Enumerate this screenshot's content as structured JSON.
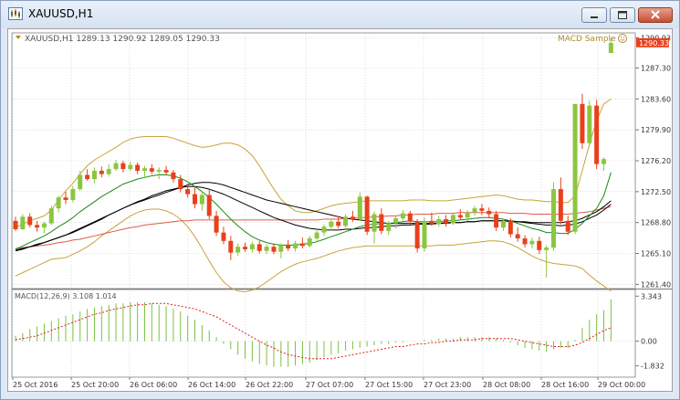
{
  "window": {
    "title": "XAUUSD,H1"
  },
  "chart_header": {
    "info": "XAUUSD,H1  1289.13 1290.92 1289.05 1290.33",
    "expert": "MACD Sample",
    "expert_icon": "smiley-icon"
  },
  "colors": {
    "background": "#ffffff",
    "grid": "#c8c8c8",
    "bull": "#8cc63f",
    "bear": "#e8401c",
    "bollinger": "#c9a33a",
    "ma_green": "#1a8a1a",
    "ma_black": "#000000",
    "ma_red": "#e05a4a",
    "macd_hist": "#7ac143",
    "macd_signal": "#e02020",
    "current_price_box": "#e8401c"
  },
  "price_axis": {
    "labels": [
      "1290.93",
      "1287.30",
      "1283.60",
      "1279.90",
      "1276.20",
      "1272.50",
      "1268.80",
      "1265.10",
      "1261.40"
    ],
    "current_price": "1290.33"
  },
  "macd_axis": {
    "labels": [
      "3.343",
      "0.00",
      "-1.832"
    ]
  },
  "macd_label": "MACD(12,26,9) 3.108 1.014",
  "time_axis": {
    "labels": [
      "25 Oct 2016",
      "25 Oct 20:00",
      "26 Oct 06:00",
      "26 Oct 14:00",
      "26 Oct 22:00",
      "27 Oct 07:00",
      "27 Oct 15:00",
      "27 Oct 23:00",
      "28 Oct 08:00",
      "28 Oct 16:00",
      "29 Oct 00:00"
    ]
  },
  "chart_data": {
    "type": "candlestick",
    "symbol": "XAUUSD",
    "timeframe": "H1",
    "ylim": [
      1261.0,
      1291.4
    ],
    "macd_ylim": [
      -2.6,
      3.7
    ],
    "candles": [
      [
        1269.0,
        1269.5,
        1267.8,
        1268.0
      ],
      [
        1268.0,
        1269.8,
        1267.9,
        1269.5
      ],
      [
        1269.5,
        1269.9,
        1268.2,
        1268.5
      ],
      [
        1268.5,
        1269.0,
        1267.7,
        1268.2
      ],
      [
        1268.2,
        1268.9,
        1267.5,
        1268.7
      ],
      [
        1268.7,
        1270.8,
        1268.5,
        1270.5
      ],
      [
        1270.5,
        1272.0,
        1270.0,
        1271.8
      ],
      [
        1271.8,
        1272.5,
        1271.0,
        1271.5
      ],
      [
        1271.5,
        1273.2,
        1271.2,
        1272.8
      ],
      [
        1272.8,
        1275.0,
        1272.6,
        1274.5
      ],
      [
        1274.5,
        1275.2,
        1273.8,
        1274.0
      ],
      [
        1274.0,
        1275.4,
        1273.5,
        1275.0
      ],
      [
        1275.0,
        1275.5,
        1274.2,
        1274.6
      ],
      [
        1274.6,
        1275.8,
        1274.3,
        1275.2
      ],
      [
        1275.2,
        1276.3,
        1275.0,
        1275.9
      ],
      [
        1275.9,
        1276.2,
        1274.8,
        1275.2
      ],
      [
        1275.2,
        1276.1,
        1275.0,
        1275.7
      ],
      [
        1275.7,
        1276.0,
        1274.6,
        1275.0
      ],
      [
        1275.0,
        1275.6,
        1274.2,
        1275.3
      ],
      [
        1275.3,
        1275.8,
        1274.6,
        1274.9
      ],
      [
        1274.9,
        1275.4,
        1274.0,
        1275.1
      ],
      [
        1275.1,
        1275.6,
        1274.5,
        1274.8
      ],
      [
        1274.8,
        1275.1,
        1273.6,
        1274.0
      ],
      [
        1274.0,
        1274.5,
        1272.4,
        1272.8
      ],
      [
        1272.8,
        1273.5,
        1271.8,
        1272.2
      ],
      [
        1272.2,
        1273.0,
        1270.5,
        1271.0
      ],
      [
        1271.0,
        1272.6,
        1270.2,
        1272.1
      ],
      [
        1272.1,
        1272.8,
        1269.2,
        1269.6
      ],
      [
        1269.6,
        1270.2,
        1267.2,
        1267.6
      ],
      [
        1267.6,
        1268.3,
        1266.2,
        1266.6
      ],
      [
        1266.6,
        1267.2,
        1264.3,
        1265.2
      ],
      [
        1265.2,
        1266.3,
        1264.8,
        1265.9
      ],
      [
        1265.9,
        1266.4,
        1265.3,
        1265.6
      ],
      [
        1265.6,
        1266.5,
        1265.2,
        1266.2
      ],
      [
        1266.2,
        1266.6,
        1265.1,
        1265.4
      ],
      [
        1265.4,
        1266.2,
        1265.0,
        1265.9
      ],
      [
        1265.9,
        1266.3,
        1265.0,
        1265.3
      ],
      [
        1265.3,
        1266.3,
        1264.5,
        1266.1
      ],
      [
        1266.1,
        1266.7,
        1265.4,
        1265.7
      ],
      [
        1265.7,
        1266.6,
        1265.3,
        1266.3
      ],
      [
        1266.3,
        1267.0,
        1265.7,
        1266.0
      ],
      [
        1266.0,
        1267.2,
        1265.8,
        1266.9
      ],
      [
        1266.9,
        1268.0,
        1266.5,
        1267.6
      ],
      [
        1267.6,
        1268.6,
        1267.2,
        1268.3
      ],
      [
        1268.3,
        1269.1,
        1267.8,
        1268.9
      ],
      [
        1268.9,
        1269.6,
        1268.1,
        1268.4
      ],
      [
        1268.4,
        1269.8,
        1268.2,
        1269.5
      ],
      [
        1269.5,
        1270.2,
        1268.9,
        1269.2
      ],
      [
        1269.2,
        1272.4,
        1269.0,
        1271.9
      ],
      [
        1271.9,
        1272.0,
        1267.3,
        1267.7
      ],
      [
        1267.7,
        1270.1,
        1266.3,
        1269.8
      ],
      [
        1269.8,
        1270.5,
        1267.4,
        1267.8
      ],
      [
        1267.8,
        1269.0,
        1267.3,
        1268.7
      ],
      [
        1268.7,
        1269.6,
        1268.1,
        1269.3
      ],
      [
        1269.3,
        1270.3,
        1268.8,
        1269.9
      ],
      [
        1269.9,
        1270.2,
        1268.6,
        1268.9
      ],
      [
        1268.9,
        1269.2,
        1265.2,
        1265.7
      ],
      [
        1265.7,
        1269.4,
        1265.3,
        1269.0
      ],
      [
        1269.0,
        1270.0,
        1268.4,
        1268.6
      ],
      [
        1268.6,
        1269.6,
        1268.3,
        1269.2
      ],
      [
        1269.2,
        1269.7,
        1268.3,
        1268.7
      ],
      [
        1268.7,
        1270.0,
        1268.5,
        1269.7
      ],
      [
        1269.7,
        1270.4,
        1269.1,
        1269.4
      ],
      [
        1269.4,
        1270.3,
        1269.0,
        1270.0
      ],
      [
        1270.0,
        1270.8,
        1269.6,
        1270.5
      ],
      [
        1270.5,
        1271.0,
        1269.7,
        1270.2
      ],
      [
        1270.2,
        1270.6,
        1269.3,
        1269.8
      ],
      [
        1269.8,
        1270.2,
        1267.8,
        1268.2
      ],
      [
        1268.2,
        1269.3,
        1267.8,
        1269.0
      ],
      [
        1269.0,
        1269.3,
        1267.0,
        1267.4
      ],
      [
        1267.4,
        1268.2,
        1266.5,
        1266.9
      ],
      [
        1266.9,
        1267.3,
        1265.8,
        1266.2
      ],
      [
        1266.2,
        1267.0,
        1265.7,
        1266.6
      ],
      [
        1266.6,
        1267.1,
        1265.0,
        1265.5
      ],
      [
        1265.5,
        1266.1,
        1262.2,
        1265.8
      ],
      [
        1265.8,
        1273.6,
        1265.4,
        1272.8
      ],
      [
        1272.8,
        1274.2,
        1268.6,
        1269.0
      ],
      [
        1269.0,
        1269.6,
        1267.3,
        1267.7
      ],
      [
        1267.7,
        1274.5,
        1267.4,
        1283.0
      ],
      [
        1283.0,
        1284.2,
        1277.6,
        1278.3
      ],
      [
        1278.3,
        1283.4,
        1277.9,
        1282.8
      ],
      [
        1282.8,
        1283.5,
        1275.2,
        1275.8
      ],
      [
        1275.8,
        1276.6,
        1275.0,
        1276.4
      ],
      [
        1289.1,
        1290.9,
        1289.1,
        1290.3
      ]
    ],
    "ma_green": [
      1265.6,
      1266.0,
      1266.4,
      1266.8,
      1267.2,
      1267.7,
      1268.3,
      1268.8,
      1269.4,
      1270.1,
      1270.7,
      1271.3,
      1271.9,
      1272.4,
      1272.9,
      1273.4,
      1273.7,
      1274.0,
      1274.2,
      1274.4,
      1274.5,
      1274.5,
      1274.4,
      1274.1,
      1273.7,
      1273.1,
      1272.5,
      1271.8,
      1271.0,
      1270.1,
      1269.2,
      1268.4,
      1267.7,
      1267.1,
      1266.7,
      1266.4,
      1266.2,
      1266.1,
      1266.1,
      1266.1,
      1266.2,
      1266.3,
      1266.5,
      1266.8,
      1267.1,
      1267.4,
      1267.7,
      1268.0,
      1268.3,
      1268.5,
      1268.6,
      1268.7,
      1268.7,
      1268.8,
      1268.9,
      1269.0,
      1268.9,
      1268.9,
      1268.9,
      1268.9,
      1269.0,
      1269.0,
      1269.1,
      1269.2,
      1269.3,
      1269.4,
      1269.4,
      1269.3,
      1269.2,
      1269.0,
      1268.7,
      1268.4,
      1268.1,
      1267.9,
      1267.6,
      1267.6,
      1267.5,
      1267.5,
      1268.0,
      1268.7,
      1269.6,
      1270.5,
      1272.0,
      1274.8
    ],
    "ma_black": [
      1265.4,
      1265.6,
      1265.9,
      1266.1,
      1266.4,
      1266.7,
      1267.0,
      1267.3,
      1267.6,
      1268.0,
      1268.4,
      1268.8,
      1269.2,
      1269.7,
      1270.1,
      1270.5,
      1270.9,
      1271.3,
      1271.6,
      1272.0,
      1272.3,
      1272.6,
      1272.8,
      1273.0,
      1273.1,
      1273.1,
      1273.0,
      1272.8,
      1272.5,
      1272.2,
      1271.8,
      1271.4,
      1271.0,
      1270.6,
      1270.2,
      1269.8,
      1269.4,
      1269.1,
      1268.8,
      1268.5,
      1268.3,
      1268.1,
      1268.0,
      1267.9,
      1267.9,
      1267.9,
      1268.0,
      1268.0,
      1268.1,
      1268.2,
      1268.2,
      1268.3,
      1268.4,
      1268.4,
      1268.5,
      1268.5,
      1268.6,
      1268.6,
      1268.6,
      1268.7,
      1268.7,
      1268.8,
      1268.8,
      1268.9,
      1268.9,
      1269.0,
      1269.0,
      1269.0,
      1269.0,
      1268.9,
      1268.9,
      1268.8,
      1268.7,
      1268.6,
      1268.5,
      1268.5,
      1268.4,
      1268.5,
      1268.6,
      1268.9,
      1269.3,
      1269.7,
      1270.3,
      1271.0
    ],
    "ma_black2": [
      1265.5,
      1265.7,
      1265.9,
      1266.2,
      1266.4,
      1266.7,
      1267.0,
      1267.3,
      1267.7,
      1268.1,
      1268.5,
      1268.9,
      1269.3,
      1269.7,
      1270.1,
      1270.5,
      1270.9,
      1271.2,
      1271.5,
      1271.8,
      1272.1,
      1272.4,
      1272.7,
      1273.0,
      1273.3,
      1273.5,
      1273.6,
      1273.6,
      1273.5,
      1273.3,
      1273.0,
      1272.7,
      1272.4,
      1272.1,
      1271.8,
      1271.5,
      1271.3,
      1271.1,
      1270.9,
      1270.7,
      1270.5,
      1270.3,
      1270.1,
      1269.9,
      1269.7,
      1269.5,
      1269.3,
      1269.2,
      1269.1,
      1269.0,
      1268.9,
      1268.8,
      1268.7,
      1268.7,
      1268.7,
      1268.7,
      1268.7,
      1268.7,
      1268.7,
      1268.7,
      1268.8,
      1268.8,
      1268.8,
      1268.9,
      1268.9,
      1269.0,
      1269.0,
      1269.0,
      1269.0,
      1269.0,
      1268.9,
      1268.9,
      1268.8,
      1268.8,
      1268.8,
      1268.8,
      1268.8,
      1268.9,
      1269.0,
      1269.3,
      1269.7,
      1270.1,
      1270.7,
      1271.4
    ],
    "ma_red": [
      1265.7,
      1265.8,
      1265.9,
      1266.0,
      1266.1,
      1266.2,
      1266.4,
      1266.5,
      1266.7,
      1266.8,
      1267.0,
      1267.2,
      1267.4,
      1267.6,
      1267.8,
      1268.0,
      1268.2,
      1268.3,
      1268.5,
      1268.6,
      1268.7,
      1268.8,
      1268.9,
      1269.0,
      1269.0,
      1269.1,
      1269.1,
      1269.1,
      1269.1,
      1269.1,
      1269.1,
      1269.1,
      1269.1,
      1269.1,
      1269.1,
      1269.1,
      1269.1,
      1269.1,
      1269.1,
      1269.1,
      1269.1,
      1269.1,
      1269.1,
      1269.2,
      1269.2,
      1269.2,
      1269.3,
      1269.3,
      1269.4,
      1269.4,
      1269.5,
      1269.5,
      1269.6,
      1269.6,
      1269.7,
      1269.7,
      1269.8,
      1269.8,
      1269.8,
      1269.9,
      1269.9,
      1269.9,
      1270.0,
      1270.0,
      1270.0,
      1270.0,
      1270.0,
      1270.0,
      1270.0,
      1269.9,
      1269.9,
      1269.9,
      1269.8,
      1269.8,
      1269.8,
      1269.8,
      1269.8,
      1269.8,
      1269.9,
      1270.0,
      1270.1,
      1270.3,
      1270.5,
      1270.7
    ],
    "bb_upper": [
      1268.2,
      1268.6,
      1269.0,
      1269.3,
      1269.6,
      1270.3,
      1271.5,
      1272.6,
      1273.5,
      1274.6,
      1275.6,
      1276.3,
      1276.8,
      1277.3,
      1277.8,
      1278.4,
      1278.8,
      1279.0,
      1279.1,
      1279.1,
      1279.1,
      1279.1,
      1278.9,
      1278.6,
      1278.3,
      1278.0,
      1277.8,
      1277.9,
      1278.1,
      1278.3,
      1278.3,
      1278.1,
      1277.6,
      1276.8,
      1275.6,
      1274.2,
      1272.8,
      1271.6,
      1270.8,
      1270.2,
      1270.0,
      1270.0,
      1270.2,
      1270.5,
      1270.8,
      1271.0,
      1271.1,
      1271.2,
      1271.3,
      1271.4,
      1271.4,
      1271.4,
      1271.4,
      1271.4,
      1271.4,
      1271.5,
      1271.5,
      1271.5,
      1271.4,
      1271.4,
      1271.4,
      1271.5,
      1271.6,
      1271.7,
      1271.8,
      1271.9,
      1272.0,
      1272.1,
      1272.0,
      1271.8,
      1271.6,
      1271.5,
      1271.5,
      1271.4,
      1271.3,
      1271.3,
      1271.2,
      1271.2,
      1272.0,
      1275.0,
      1278.2,
      1281.0,
      1283.0,
      1283.6
    ],
    "bb_lower": [
      1262.4,
      1262.8,
      1263.2,
      1263.6,
      1264.0,
      1264.4,
      1264.5,
      1264.6,
      1265.0,
      1265.4,
      1265.9,
      1266.5,
      1267.2,
      1267.8,
      1268.4,
      1269.0,
      1269.6,
      1270.0,
      1270.3,
      1270.4,
      1270.4,
      1270.2,
      1269.8,
      1269.2,
      1268.3,
      1267.1,
      1265.7,
      1264.2,
      1262.8,
      1261.7,
      1261.0,
      1260.6,
      1260.5,
      1260.7,
      1261.1,
      1261.7,
      1262.3,
      1262.9,
      1263.4,
      1263.8,
      1264.1,
      1264.3,
      1264.5,
      1264.8,
      1265.1,
      1265.4,
      1265.6,
      1265.8,
      1265.9,
      1266.0,
      1266.0,
      1266.0,
      1266.0,
      1266.0,
      1266.0,
      1266.0,
      1266.0,
      1266.0,
      1266.0,
      1266.1,
      1266.1,
      1266.1,
      1266.2,
      1266.3,
      1266.4,
      1266.5,
      1266.6,
      1266.6,
      1266.5,
      1266.2,
      1265.8,
      1265.3,
      1264.8,
      1264.4,
      1264.1,
      1263.9,
      1263.8,
      1263.7,
      1263.6,
      1263.3,
      1262.5,
      1261.8,
      1261.2,
      1260.6
    ],
    "macd_hist": [
      0.4,
      0.6,
      0.9,
      1.1,
      1.3,
      1.5,
      1.7,
      1.9,
      2.0,
      2.2,
      2.4,
      2.5,
      2.6,
      2.7,
      2.8,
      2.8,
      2.9,
      2.9,
      2.9,
      2.8,
      2.7,
      2.6,
      2.4,
      2.2,
      1.9,
      1.6,
      1.2,
      0.8,
      0.3,
      -0.2,
      -0.6,
      -1.0,
      -1.3,
      -1.5,
      -1.7,
      -1.8,
      -1.9,
      -1.9,
      -1.9,
      -1.8,
      -1.7,
      -1.6,
      -1.4,
      -1.2,
      -1.0,
      -0.9,
      -0.7,
      -0.6,
      -0.5,
      -0.4,
      -0.3,
      -0.2,
      -0.2,
      -0.1,
      -0.1,
      0.0,
      0.0,
      0.1,
      0.1,
      0.2,
      0.2,
      0.2,
      0.3,
      0.3,
      0.3,
      0.3,
      0.3,
      0.2,
      0.1,
      -0.1,
      -0.3,
      -0.5,
      -0.6,
      -0.7,
      -0.8,
      -0.6,
      -0.5,
      -0.5,
      0.1,
      1.0,
      1.6,
      2.0,
      2.3,
      3.1
    ],
    "macd_signal": [
      0.1,
      0.2,
      0.3,
      0.4,
      0.6,
      0.8,
      1.0,
      1.2,
      1.4,
      1.6,
      1.8,
      2.0,
      2.1,
      2.3,
      2.4,
      2.5,
      2.6,
      2.7,
      2.7,
      2.8,
      2.8,
      2.8,
      2.7,
      2.6,
      2.5,
      2.4,
      2.2,
      2.0,
      1.8,
      1.5,
      1.2,
      0.9,
      0.6,
      0.3,
      0.0,
      -0.3,
      -0.5,
      -0.8,
      -1.0,
      -1.1,
      -1.2,
      -1.3,
      -1.3,
      -1.3,
      -1.3,
      -1.2,
      -1.1,
      -1.0,
      -0.9,
      -0.8,
      -0.7,
      -0.6,
      -0.5,
      -0.4,
      -0.4,
      -0.3,
      -0.2,
      -0.2,
      -0.1,
      -0.1,
      0.0,
      0.0,
      0.1,
      0.1,
      0.1,
      0.2,
      0.2,
      0.2,
      0.2,
      0.2,
      0.1,
      0.0,
      -0.1,
      -0.2,
      -0.3,
      -0.4,
      -0.4,
      -0.4,
      -0.3,
      -0.1,
      0.2,
      0.5,
      0.8,
      1.0
    ]
  }
}
